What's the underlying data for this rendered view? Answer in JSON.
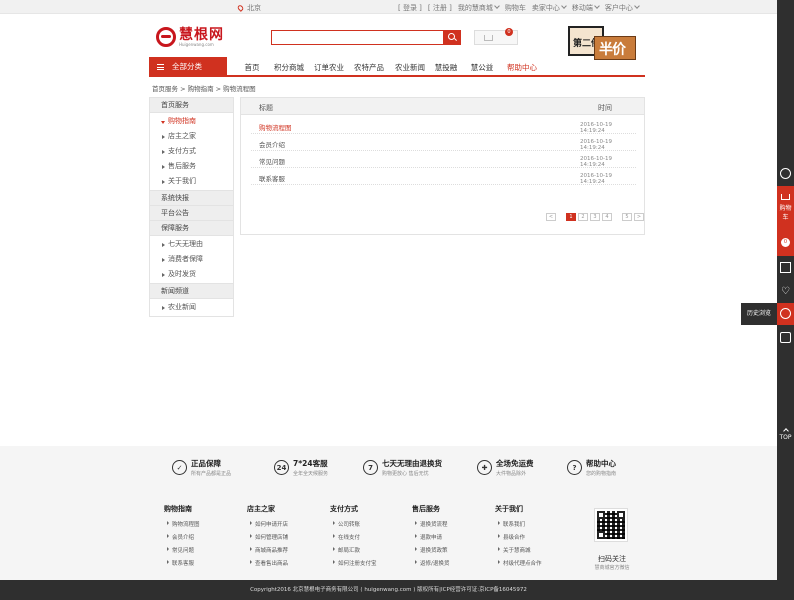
{
  "topbar": {
    "location": "北京",
    "login": "[ 登录 ]",
    "register": "[ 注册 ]",
    "my_mall": "我的慧商城",
    "cart": "购物车",
    "seller_center": "卖家中心",
    "mobile": "移动端",
    "customer_center": "客户中心"
  },
  "header": {
    "logo_cn": "慧根网",
    "logo_en": "Huigenwang.com",
    "search_placeholder": "",
    "cart_count": "0",
    "promo_line1": "第二件",
    "promo_line2": "半价"
  },
  "nav": {
    "all_categories": "全部分类",
    "items": [
      "首页",
      "积分商城",
      "订单农业",
      "农特产品",
      "农业新闻",
      "慧投融",
      "慧公益",
      "帮助中心"
    ],
    "active_index": 7
  },
  "breadcrumb": "首页服务 > 购物指南 > 购物流程图",
  "sidebar": {
    "groups": [
      {
        "title": "首页服务",
        "items": [
          "购物指南",
          "店主之家",
          "支付方式",
          "售后服务",
          "关于我们"
        ]
      },
      {
        "title": "系统快报",
        "items": []
      },
      {
        "title": "平台公告",
        "items": []
      },
      {
        "title": "保障服务",
        "items": [
          "七天无理由",
          "消费者保障",
          "及时发货"
        ]
      },
      {
        "title": "新闻频道",
        "items": [
          "农业新闻"
        ]
      }
    ],
    "active_item": "购物指南"
  },
  "table": {
    "col_title": "标题",
    "col_time": "时间",
    "rows": [
      {
        "title": "购物流程图",
        "time": "2016-10-19 14:19:24"
      },
      {
        "title": "会员介绍",
        "time": "2016-10-19 14:19:24"
      },
      {
        "title": "常见问题",
        "time": "2016-10-19 14:19:24"
      },
      {
        "title": "联系客服",
        "time": "2016-10-19 14:19:24"
      }
    ],
    "pager": {
      "prev": "<",
      "pages": [
        "1",
        "2",
        "3",
        "4",
        "5"
      ],
      "current": "1",
      "next": ">"
    }
  },
  "right_toolbar": {
    "cart_label": "购物车",
    "cart_count": "0",
    "history_tip": "历史浏览",
    "top": "TOP"
  },
  "footer": {
    "guarantees": [
      {
        "icon": "shield-icon",
        "glyph": "✓",
        "title": "正品保障",
        "sub": "所有产品都是正品"
      },
      {
        "icon": "24h-icon",
        "glyph": "24",
        "title": "7*24客服",
        "sub": "全年全天候服务"
      },
      {
        "icon": "seven-day-icon",
        "glyph": "7",
        "title": "七天无理由退换货",
        "sub": "购物更放心 售后无忧"
      },
      {
        "icon": "gift-icon",
        "glyph": "✚",
        "title": "全场免运费",
        "sub": "大件物品除外"
      },
      {
        "icon": "help-icon",
        "glyph": "?",
        "title": "帮助中心",
        "sub": "您的购物指南"
      }
    ],
    "columns": [
      {
        "title": "购物指南",
        "links": [
          "购物流程图",
          "会员介绍",
          "常见问题",
          "联系客服"
        ]
      },
      {
        "title": "店主之家",
        "links": [
          "如何申请开店",
          "如何管理店铺",
          "商城商品推荐",
          "查看售出商品"
        ]
      },
      {
        "title": "支付方式",
        "links": [
          "公司转账",
          "在线支付",
          "邮局汇款",
          "如何注册支付宝"
        ]
      },
      {
        "title": "售后服务",
        "links": [
          "退换货流程",
          "退款申请",
          "退换货政策",
          "返修/退换货"
        ]
      },
      {
        "title": "关于我们",
        "links": [
          "联系我们",
          "县级合作",
          "关于慧商城",
          "村级代理点合作"
        ]
      }
    ],
    "qr_title": "扫码关注",
    "qr_sub": "慧商城官方微信",
    "copyright": "Copyright2016 北京慧根电子商务有限公司 ( huigenwang.com ) 版权所有|ICP经营许可证:京ICP备16045972"
  },
  "colors": {
    "accent": "#d0311f",
    "dark": "#2f2f2f"
  }
}
